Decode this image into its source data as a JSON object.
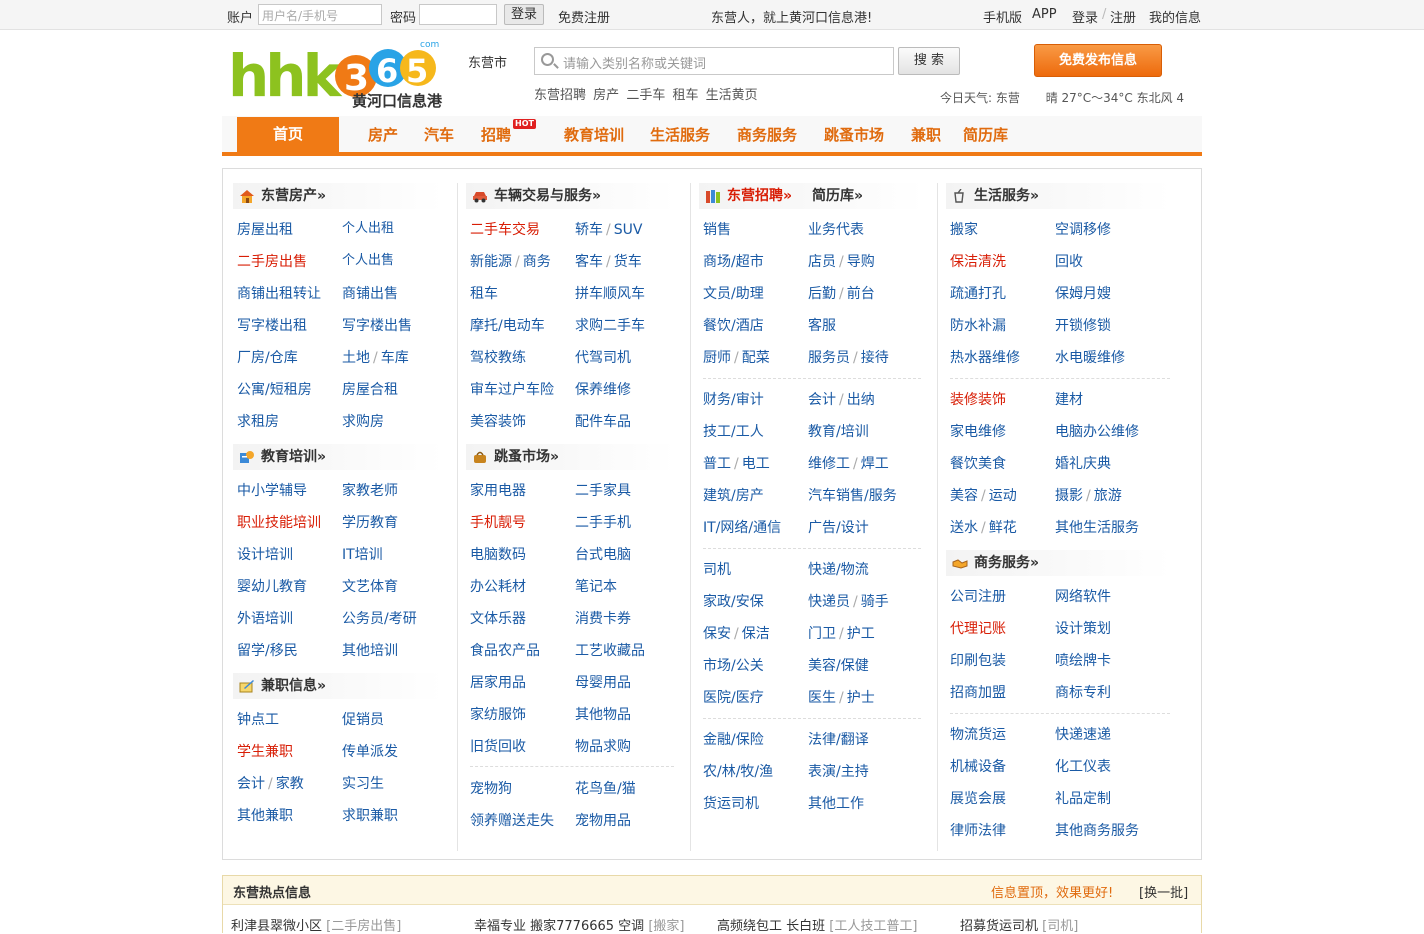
{
  "topbar": {
    "account_label": "账户",
    "account_placeholder": "用户名/手机号",
    "password_label": "密码",
    "login_button": "登录",
    "register_link": "免费注册",
    "slogan": "东营人，就上黄河口信息港!",
    "links": [
      "手机版",
      "APP",
      "登录",
      "注册",
      "我的信息"
    ]
  },
  "header": {
    "logo_text": "hhk365",
    "logo_com": "com",
    "logo_subtitle": "黄河口信息港",
    "city": "东营市",
    "search_placeholder": "请输入类别名称或关键词",
    "search_button": "搜 索",
    "hot_links": [
      "东营招聘",
      "房产",
      "二手车",
      "租车",
      "生活黄页"
    ],
    "publish_button": "免费发布信息",
    "weather_label": "今日天气: 东营",
    "weather_value": "晴 27°C～34°C 东北风 4"
  },
  "nav": {
    "home": "首页",
    "items": [
      "房产",
      "汽车",
      "招聘",
      "教育培训",
      "生活服务",
      "商务服务",
      "跳蚤市场",
      "兼职",
      "简历库"
    ],
    "hot_badge": "HOT"
  },
  "sections": {
    "house": {
      "title": "东营房产»",
      "items": [
        "房屋出租",
        "个人出租",
        "二手房出售",
        "个人出售",
        "商铺出租转让",
        "商铺出售",
        "写字楼出租",
        "写字楼出售",
        "厂房/仓库",
        "土地",
        "车库",
        "公寓/短租房",
        "房屋合租",
        "求租房",
        "求购房"
      ]
    },
    "edu": {
      "title": "教育培训»",
      "items": [
        "中小学辅导",
        "家教老师",
        "职业技能培训",
        "学历教育",
        "设计培训",
        "IT培训",
        "婴幼儿教育",
        "文艺体育",
        "外语培训",
        "公务员/考研",
        "留学/移民",
        "其他培训"
      ]
    },
    "parttime": {
      "title": "兼职信息»",
      "items": [
        "钟点工",
        "促销员",
        "学生兼职",
        "传单派发",
        "会计",
        "家教",
        "实习生",
        "其他兼职",
        "求职兼职"
      ]
    },
    "car": {
      "title": "车辆交易与服务»",
      "items": [
        "二手车交易",
        "轿车",
        "SUV",
        "新能源",
        "商务",
        "客车",
        "货车",
        "租车",
        "拼车顺风车",
        "摩托/电动车",
        "求购二手车",
        "驾校教练",
        "代驾司机",
        "审车过户车险",
        "保养维修",
        "美容装饰",
        "配件车品"
      ]
    },
    "flea": {
      "title": "跳蚤市场»",
      "items": [
        "家用电器",
        "二手家具",
        "手机靓号",
        "二手手机",
        "电脑数码",
        "台式电脑",
        "办公耗材",
        "笔记本",
        "文体乐器",
        "消费卡券",
        "食品农产品",
        "工艺收藏品",
        "居家用品",
        "母婴用品",
        "家纺服饰",
        "其他物品",
        "旧货回收",
        "物品求购",
        "宠物狗",
        "花鸟鱼/猫",
        "领养赠送走失",
        "宠物用品"
      ]
    },
    "jobs": {
      "title": "东营招聘»",
      "sub": "简历库»",
      "items": [
        "销售",
        "业务代表",
        "商场/超市",
        "店员",
        "导购",
        "文员/助理",
        "后勤",
        "前台",
        "餐饮/酒店",
        "客服",
        "厨师",
        "配菜",
        "服务员",
        "接待",
        "财务/审计",
        "会计",
        "出纳",
        "技工/工人",
        "教育/培训",
        "普工",
        "电工",
        "维修工",
        "焊工",
        "建筑/房产",
        "汽车销售/服务",
        "IT/网络/通信",
        "广告/设计",
        "司机",
        "快递/物流",
        "家政/安保",
        "快递员",
        "骑手",
        "保安",
        "保洁",
        "门卫",
        "护工",
        "市场/公关",
        "美容/保健",
        "医院/医疗",
        "医生",
        "护士",
        "金融/保险",
        "法律/翻译",
        "农/林/牧/渔",
        "表演/主持",
        "货运司机",
        "其他工作"
      ]
    },
    "life": {
      "title": "生活服务»",
      "items": [
        "搬家",
        "空调移修",
        "保洁清洗",
        "回收",
        "疏通打孔",
        "保姆月嫂",
        "防水补漏",
        "开锁修锁",
        "热水器维修",
        "水电暖维修",
        "装修装饰",
        "建材",
        "家电维修",
        "电脑办公维修",
        "餐饮美食",
        "婚礼庆典",
        "美容",
        "运动",
        "摄影",
        "旅游",
        "送水",
        "鲜花",
        "其他生活服务"
      ]
    },
    "biz": {
      "title": "商务服务»",
      "items": [
        "公司注册",
        "网络软件",
        "代理记账",
        "设计策划",
        "印刷包装",
        "喷绘牌卡",
        "招商加盟",
        "商标专利",
        "物流货运",
        "快递速递",
        "机械设备",
        "化工仪表",
        "展览会展",
        "礼品定制",
        "律师法律",
        "其他商务服务"
      ]
    }
  },
  "hot": {
    "title": "东营热点信息",
    "promo": "信息置顶，效果更好!",
    "batch": "[换一批]",
    "rows": [
      {
        "text": "利津县翠微小区",
        "cat": "[二手房出售]"
      },
      {
        "text": "幸福专业 搬家7776665 空调",
        "cat": "[搬家]"
      },
      {
        "text": "高频绕包工 长白班",
        "cat": "[工人技工普工]"
      },
      {
        "text": "招募货运司机",
        "cat": "[司机]"
      }
    ]
  },
  "colors": {
    "accent": "#f07a15",
    "link": "#1a5aa5",
    "highlight": "#d81e06",
    "logo_green": "#8dc21f"
  }
}
